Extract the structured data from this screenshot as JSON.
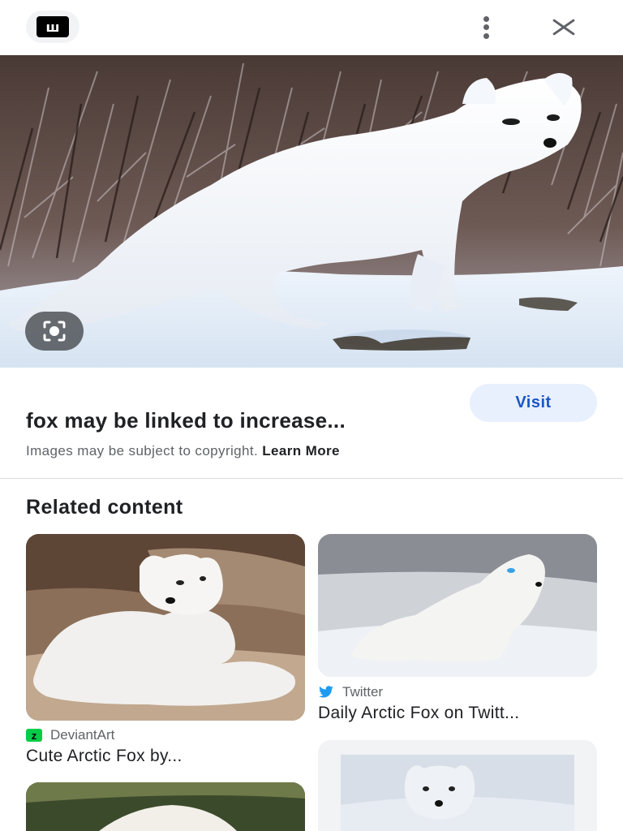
{
  "top_bar": {
    "site_favicon_icon": "site-favicon-icon",
    "site_favicon_text": "ш",
    "more_icon": "more-vert-icon",
    "close_icon": "close-icon"
  },
  "main_image": {
    "subject": "arctic fox in snow",
    "lens_icon": "google-lens-icon"
  },
  "caption": {
    "visit_label": "Visit",
    "title": "fox may be linked to increase...",
    "copyright_text": "Images may be subject to copyright.",
    "learn_more": "Learn More"
  },
  "related": {
    "heading": "Related content",
    "items": [
      {
        "source": "DeviantArt",
        "source_icon": "deviantart-icon",
        "title": "Cute Arctic Fox by..."
      },
      {
        "source": "Twitter",
        "source_icon": "twitter-icon",
        "title": "Daily Arctic Fox on Twitt..."
      }
    ]
  },
  "colors": {
    "accent_blue": "#1a56c5",
    "visit_bg": "#e8f0fe",
    "twitter_blue": "#1d9bf0",
    "deviantart_green": "#05cc47"
  }
}
